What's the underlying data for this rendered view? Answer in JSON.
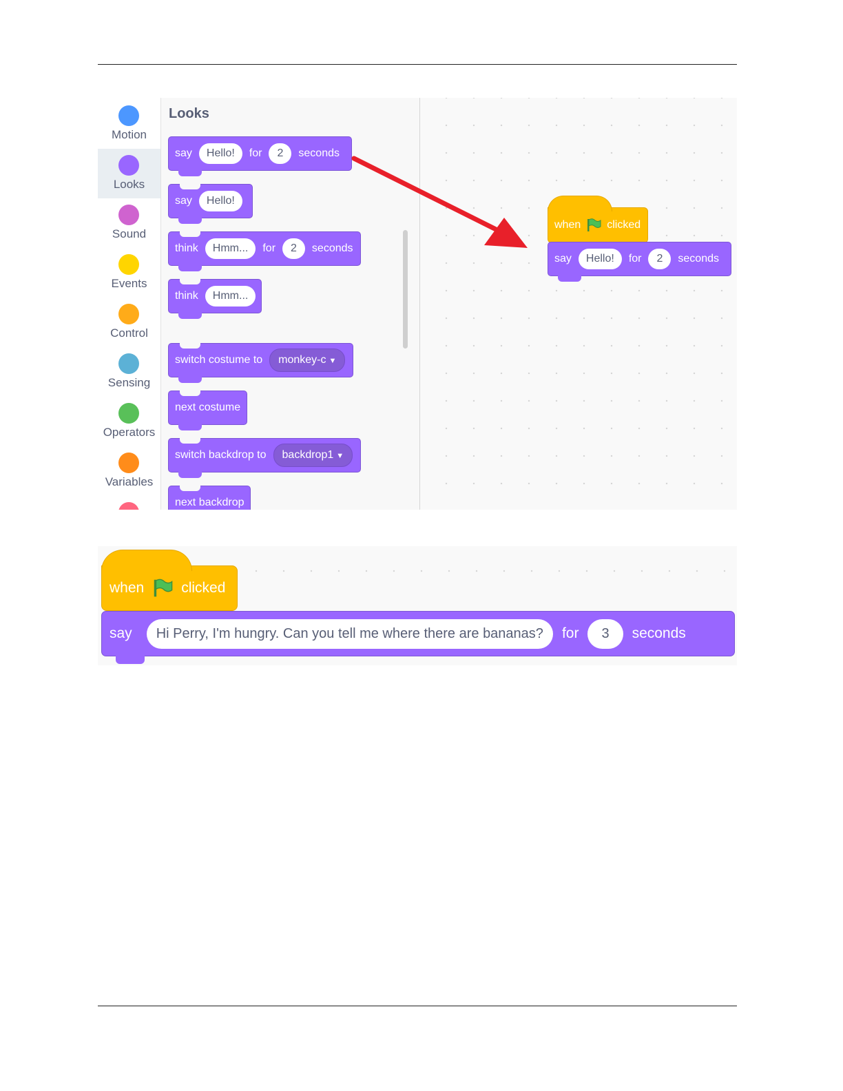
{
  "categories": [
    {
      "label": "Motion",
      "color": "#4c97ff"
    },
    {
      "label": "Looks",
      "color": "#9966ff"
    },
    {
      "label": "Sound",
      "color": "#cf63cf"
    },
    {
      "label": "Events",
      "color": "#ffd500"
    },
    {
      "label": "Control",
      "color": "#ffab19"
    },
    {
      "label": "Sensing",
      "color": "#5cb1d6"
    },
    {
      "label": "Operators",
      "color": "#59c059"
    },
    {
      "label": "Variables",
      "color": "#ff8c1a"
    }
  ],
  "active_category": "Looks",
  "palette": {
    "title": "Looks",
    "say_for": {
      "say": "say",
      "msg": "Hello!",
      "for": "for",
      "secs": "2",
      "seconds": "seconds"
    },
    "say": {
      "say": "say",
      "msg": "Hello!"
    },
    "think_for": {
      "think": "think",
      "msg": "Hmm...",
      "for": "for",
      "secs": "2",
      "seconds": "seconds"
    },
    "think": {
      "think": "think",
      "msg": "Hmm..."
    },
    "switch_costume": {
      "label": "switch costume to",
      "value": "monkey-c"
    },
    "next_costume": {
      "label": "next costume"
    },
    "switch_backdrop": {
      "label": "switch backdrop to",
      "value": "backdrop1"
    },
    "next_backdrop": {
      "label": "next backdrop"
    }
  },
  "workspace_script": {
    "when": "when",
    "clicked": "clicked",
    "say": "say",
    "msg": "Hello!",
    "for": "for",
    "secs": "2",
    "seconds": "seconds"
  },
  "script2": {
    "when": "when",
    "clicked": "clicked",
    "say": "say",
    "msg": "Hi Perry, I'm hungry. Can you tell me where there are bananas?",
    "for": "for",
    "secs": "3",
    "seconds": "seconds"
  },
  "colors": {
    "looks": "#9966ff",
    "events": "#ffbf00",
    "arrow": "#e8202a",
    "flag": "#4cbf56"
  }
}
